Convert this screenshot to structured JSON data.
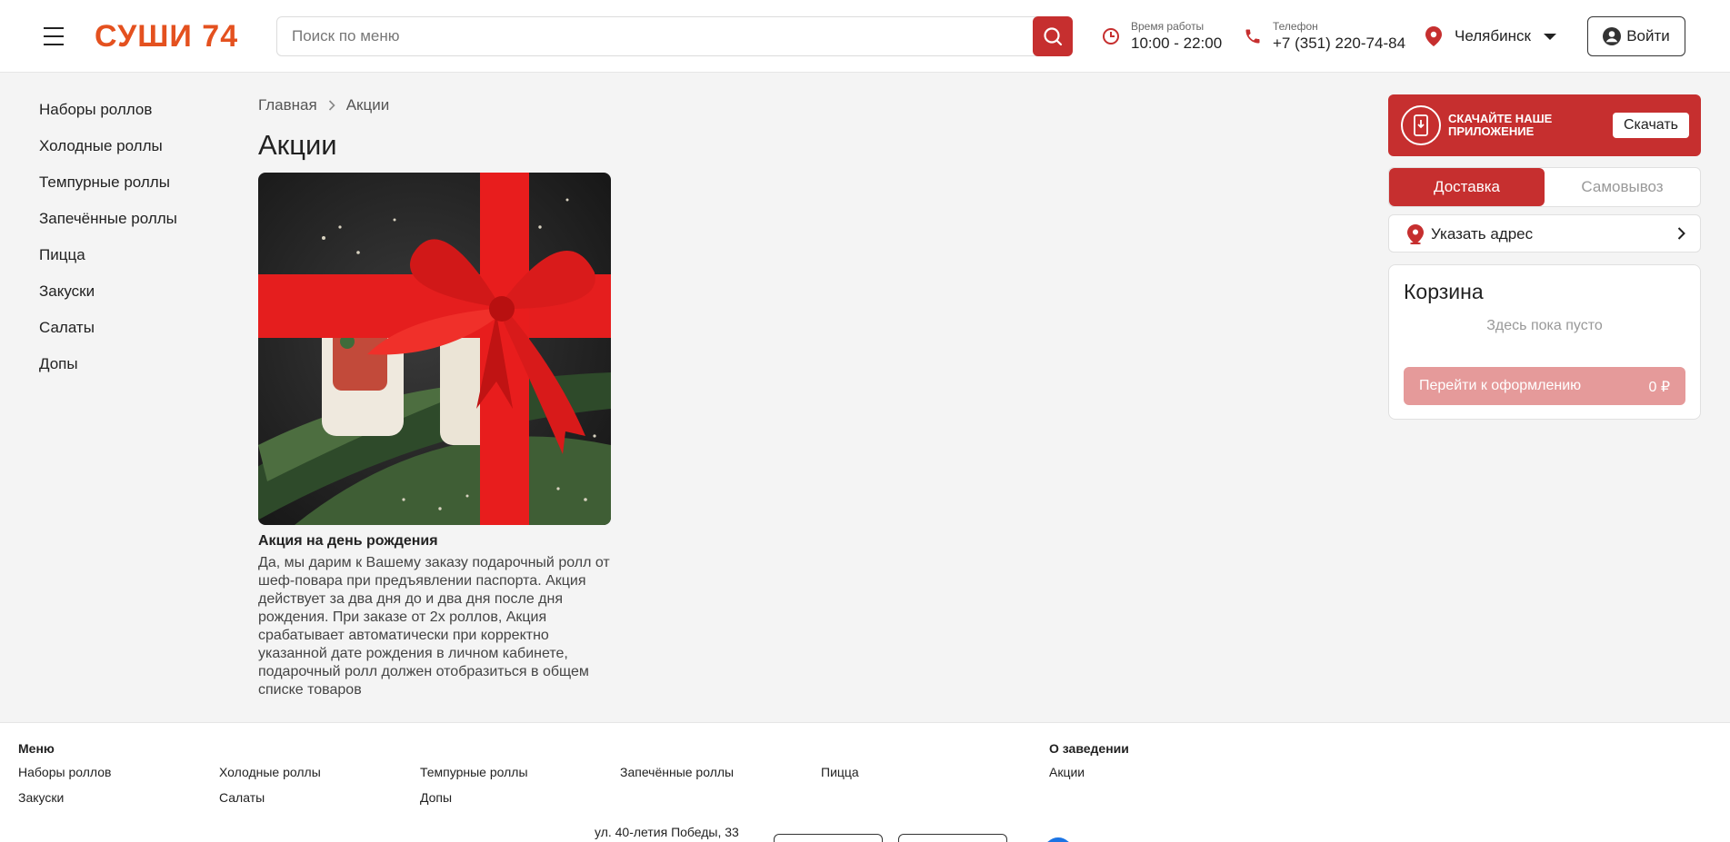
{
  "header": {
    "logo": "СУШИ 74",
    "search_placeholder": "Поиск по меню",
    "hours_label": "Время работы",
    "hours_value": "10:00 - 22:00",
    "phone_label": "Телефон",
    "phone_value": "+7 (351) 220-74-84",
    "city": "Челябинск",
    "login_label": "Войти"
  },
  "sidebar": {
    "items": [
      {
        "label": "Наборы роллов"
      },
      {
        "label": "Холодные роллы"
      },
      {
        "label": "Темпурные роллы"
      },
      {
        "label": "Запечённые роллы"
      },
      {
        "label": "Пицца"
      },
      {
        "label": "Закуски"
      },
      {
        "label": "Салаты"
      },
      {
        "label": "Допы"
      }
    ]
  },
  "breadcrumb": {
    "home": "Главная",
    "current": "Акции"
  },
  "main": {
    "title": "Акции",
    "promo": {
      "title": "Акция на день рождения",
      "text": "Да, мы дарим к Вашему заказу подарочный ролл от шеф-повара при предъявлении паспорта. Акция действует за два дня до и два дня после дня рождения. При заказе от 2х роллов, Акция срабатывает автоматически при корректно указанной дате рождения в личном кабинете, подарочный ролл должен отобразиться в общем списке товаров"
    }
  },
  "right_panel": {
    "app_banner_text": "Скачайте наше приложение",
    "app_banner_button": "Скачать",
    "tabs": [
      {
        "label": "Доставка"
      },
      {
        "label": "Самовывоз"
      }
    ],
    "address_label": "Указать адрес",
    "cart": {
      "title": "Корзина",
      "empty_text": "Здесь пока пусто",
      "checkout_label": "Перейти к оформлению",
      "total": "0 ₽"
    }
  },
  "footer": {
    "menu_heading": "Меню",
    "menu_links": [
      {
        "label": "Наборы роллов"
      },
      {
        "label": "Холодные роллы"
      },
      {
        "label": "Темпурные роллы"
      },
      {
        "label": "Запечённые роллы"
      },
      {
        "label": "Пицца"
      },
      {
        "label": "Закуски"
      },
      {
        "label": "Салаты"
      },
      {
        "label": "Допы"
      }
    ],
    "about_heading": "О заведении",
    "about_links": [
      {
        "label": "Акции"
      }
    ],
    "address": "ул. 40-летия Победы, 33"
  },
  "colors": {
    "accent": "#c62f2f",
    "logo": "#e4511f",
    "background": "#f4f4f4"
  },
  "icons": {
    "menu": "hamburger-menu-icon",
    "search": "search-icon",
    "clock": "clock-icon",
    "phone": "phone-icon",
    "location": "location-pin-icon",
    "user": "user-icon",
    "app": "mobile-app-icon",
    "chevron": "chevron-right-icon"
  }
}
